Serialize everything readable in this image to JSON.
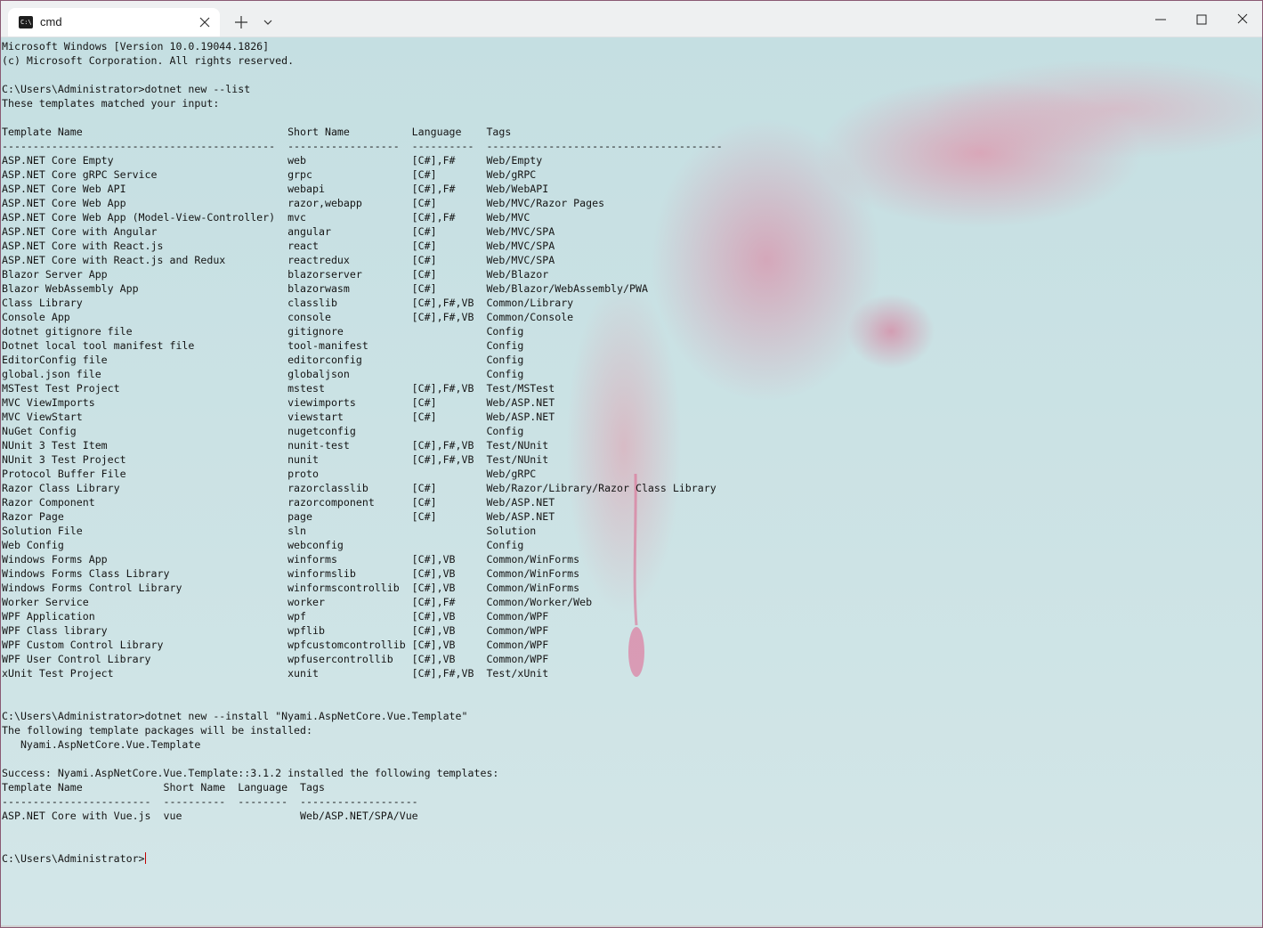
{
  "window": {
    "tab_title": "cmd",
    "tab_icon": "console-icon"
  },
  "titlebar": {
    "new_tab_icon": "plus-icon",
    "dropdown_icon": "chevron-down-icon",
    "minimize_icon": "minimize-icon",
    "maximize_icon": "maximize-icon",
    "close_icon": "close-icon"
  },
  "colors": {
    "text": "#151515",
    "cursor": "#c00000",
    "titlebar": "#eef0f1",
    "background": "#c8e0e2",
    "flower": "#e07896"
  },
  "console": {
    "lines": [
      "Microsoft Windows [Version 10.0.19044.1826]",
      "(c) Microsoft Corporation. All rights reserved.",
      "",
      "C:\\Users\\Administrator>dotnet new --list",
      "These templates matched your input:",
      "",
      "Template Name                                 Short Name          Language    Tags",
      "--------------------------------------------  ------------------  ----------  --------------------------------------",
      "ASP.NET Core Empty                            web                 [C#],F#     Web/Empty",
      "ASP.NET Core gRPC Service                     grpc                [C#]        Web/gRPC",
      "ASP.NET Core Web API                          webapi              [C#],F#     Web/WebAPI",
      "ASP.NET Core Web App                          razor,webapp        [C#]        Web/MVC/Razor Pages",
      "ASP.NET Core Web App (Model-View-Controller)  mvc                 [C#],F#     Web/MVC",
      "ASP.NET Core with Angular                     angular             [C#]        Web/MVC/SPA",
      "ASP.NET Core with React.js                    react               [C#]        Web/MVC/SPA",
      "ASP.NET Core with React.js and Redux          reactredux          [C#]        Web/MVC/SPA",
      "Blazor Server App                             blazorserver        [C#]        Web/Blazor",
      "Blazor WebAssembly App                        blazorwasm          [C#]        Web/Blazor/WebAssembly/PWA",
      "Class Library                                 classlib            [C#],F#,VB  Common/Library",
      "Console App                                   console             [C#],F#,VB  Common/Console",
      "dotnet gitignore file                         gitignore                       Config",
      "Dotnet local tool manifest file               tool-manifest                   Config",
      "EditorConfig file                             editorconfig                    Config",
      "global.json file                              globaljson                      Config",
      "MSTest Test Project                           mstest              [C#],F#,VB  Test/MSTest",
      "MVC ViewImports                               viewimports         [C#]        Web/ASP.NET",
      "MVC ViewStart                                 viewstart           [C#]        Web/ASP.NET",
      "NuGet Config                                  nugetconfig                     Config",
      "NUnit 3 Test Item                             nunit-test          [C#],F#,VB  Test/NUnit",
      "NUnit 3 Test Project                          nunit               [C#],F#,VB  Test/NUnit",
      "Protocol Buffer File                          proto                           Web/gRPC",
      "Razor Class Library                           razorclasslib       [C#]        Web/Razor/Library/Razor Class Library",
      "Razor Component                               razorcomponent      [C#]        Web/ASP.NET",
      "Razor Page                                    page                [C#]        Web/ASP.NET",
      "Solution File                                 sln                             Solution",
      "Web Config                                    webconfig                       Config",
      "Windows Forms App                             winforms            [C#],VB     Common/WinForms",
      "Windows Forms Class Library                   winformslib         [C#],VB     Common/WinForms",
      "Windows Forms Control Library                 winformscontrollib  [C#],VB     Common/WinForms",
      "Worker Service                                worker              [C#],F#     Common/Worker/Web",
      "WPF Application                               wpf                 [C#],VB     Common/WPF",
      "WPF Class library                             wpflib              [C#],VB     Common/WPF",
      "WPF Custom Control Library                    wpfcustomcontrollib [C#],VB     Common/WPF",
      "WPF User Control Library                      wpfusercontrollib   [C#],VB     Common/WPF",
      "xUnit Test Project                            xunit               [C#],F#,VB  Test/xUnit",
      "",
      "",
      "C:\\Users\\Administrator>dotnet new --install \"Nyami.AspNetCore.Vue.Template\"",
      "The following template packages will be installed:",
      "   Nyami.AspNetCore.Vue.Template",
      "",
      "Success: Nyami.AspNetCore.Vue.Template::3.1.2 installed the following templates:",
      "Template Name             Short Name  Language  Tags",
      "------------------------  ----------  --------  -------------------",
      "ASP.NET Core with Vue.js  vue                   Web/ASP.NET/SPA/Vue",
      "",
      ""
    ],
    "prompt": "C:\\Users\\Administrator>"
  }
}
